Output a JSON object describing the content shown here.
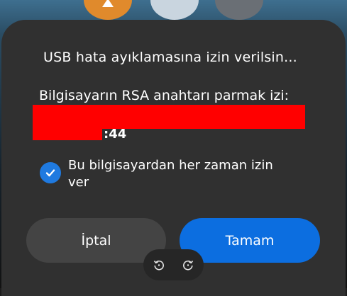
{
  "dialog": {
    "title": "USB hata ayıklamasına izin verilsin...",
    "fingerprint_label": "Bilgisayarın RSA anahtarı parmak izi:",
    "fingerprint_visible_tail": ":44",
    "always_allow_label": "Bu bilgisayardan her zaman izin ver",
    "always_allow_checked": true,
    "cancel_label": "İptal",
    "ok_label": "Tamam"
  },
  "colors": {
    "dialog_bg": "#303030",
    "accent": "#0c6ee0",
    "redaction": "#ff0000"
  },
  "icons": {
    "checkbox": "check-icon",
    "rotate_left": "rotate-left-icon",
    "rotate_right": "rotate-right-icon"
  }
}
